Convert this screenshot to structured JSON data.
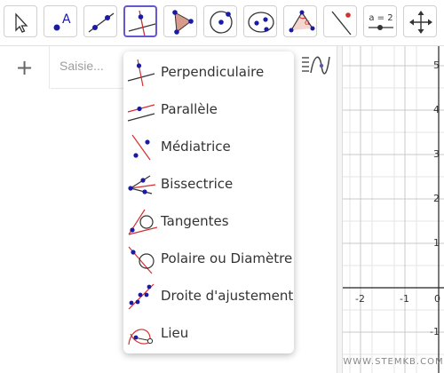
{
  "toolbar": {
    "tools": [
      {
        "name": "move-tool",
        "icon": "cursor-arrow-icon"
      },
      {
        "name": "point-tool",
        "icon": "point-A-icon"
      },
      {
        "name": "line-tool",
        "icon": "line-through-two-points-icon"
      },
      {
        "name": "perpendicular-line-tool",
        "icon": "perpendicular-line-icon",
        "selected": true
      },
      {
        "name": "polygon-tool",
        "icon": "polygon-icon"
      },
      {
        "name": "circle-tool",
        "icon": "circle-center-point-icon"
      },
      {
        "name": "conic-tool",
        "icon": "ellipse-icon"
      },
      {
        "name": "angle-tool",
        "icon": "angle-icon",
        "label": "α"
      },
      {
        "name": "reflect-tool",
        "icon": "reflect-about-line-icon"
      },
      {
        "name": "slider-tool",
        "icon": "slider-icon",
        "label": "a = 2"
      },
      {
        "name": "move-graphics-tool",
        "icon": "move-graphics-view-icon"
      }
    ]
  },
  "algebra": {
    "add_button_label": "+",
    "input_placeholder": "Saisie..."
  },
  "dropdown": {
    "items": [
      {
        "label": "Perpendiculaire",
        "icon": "perpendicular-line-icon"
      },
      {
        "label": "Parallèle",
        "icon": "parallel-line-icon"
      },
      {
        "label": "Médiatrice",
        "icon": "perpendicular-bisector-icon"
      },
      {
        "label": "Bissectrice",
        "icon": "angle-bisector-icon"
      },
      {
        "label": "Tangentes",
        "icon": "tangents-icon"
      },
      {
        "label": "Polaire ou Diamètre",
        "icon": "polar-diameter-icon"
      },
      {
        "label": "Droite d'ajustement",
        "icon": "best-fit-line-icon"
      },
      {
        "label": "Lieu",
        "icon": "locus-icon"
      }
    ]
  },
  "graphics": {
    "y_ticks": [
      "5",
      "4",
      "3",
      "2",
      "1",
      "-1"
    ],
    "x_ticks": [
      "-2",
      "-1",
      "0"
    ]
  },
  "colors": {
    "accent": "#6557d2",
    "point": "#1a1aa6",
    "line_red": "#d32f2f",
    "polygon_fill": "#d89a8a"
  },
  "watermark": "WWW.STEMKB.COM"
}
